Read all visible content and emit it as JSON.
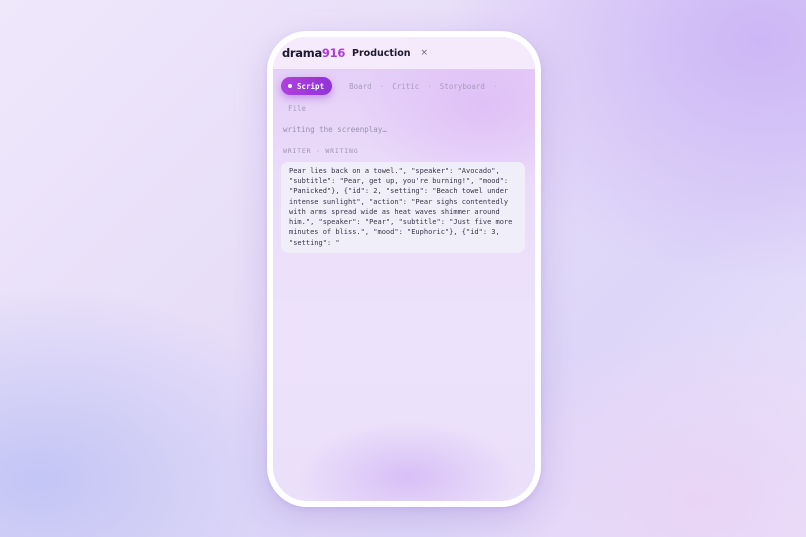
{
  "header": {
    "logo_main": "drama",
    "logo_accent": "916",
    "title": "Production",
    "close_symbol": "×"
  },
  "tabs": [
    {
      "label": "Script",
      "active": true
    },
    {
      "label": "Board",
      "active": false
    },
    {
      "label": "Critic",
      "active": false
    },
    {
      "label": "Storyboard",
      "active": false
    },
    {
      "label": "File",
      "active": false
    }
  ],
  "separator": "·",
  "status": "writing the screenplay…",
  "section_label": "WRITER · WRITING",
  "stream_output": "Pear lies back on a towel.\", \"speaker\": \"Avocado\", \"subtitle\": \"Pear, get up, you're burning!\", \"mood\": \"Panicked\"}, {\"id\": 2, \"setting\": \"Beach towel under intense sunlight\", \"action\": \"Pear sighs contentedly with arms spread wide as heat waves shimmer around him.\", \"speaker\": \"Pear\", \"subtitle\": \"Just five more minutes of bliss.\", \"mood\": \"Euphoric\"}, {\"id\": 3, \"setting\": \"",
  "colors": {
    "accent": "#b03ad9",
    "tab_active_start": "#b23ee0",
    "tab_active_end": "#8f34d9",
    "text_dark": "#1e1830",
    "muted": "#a89cbc"
  }
}
